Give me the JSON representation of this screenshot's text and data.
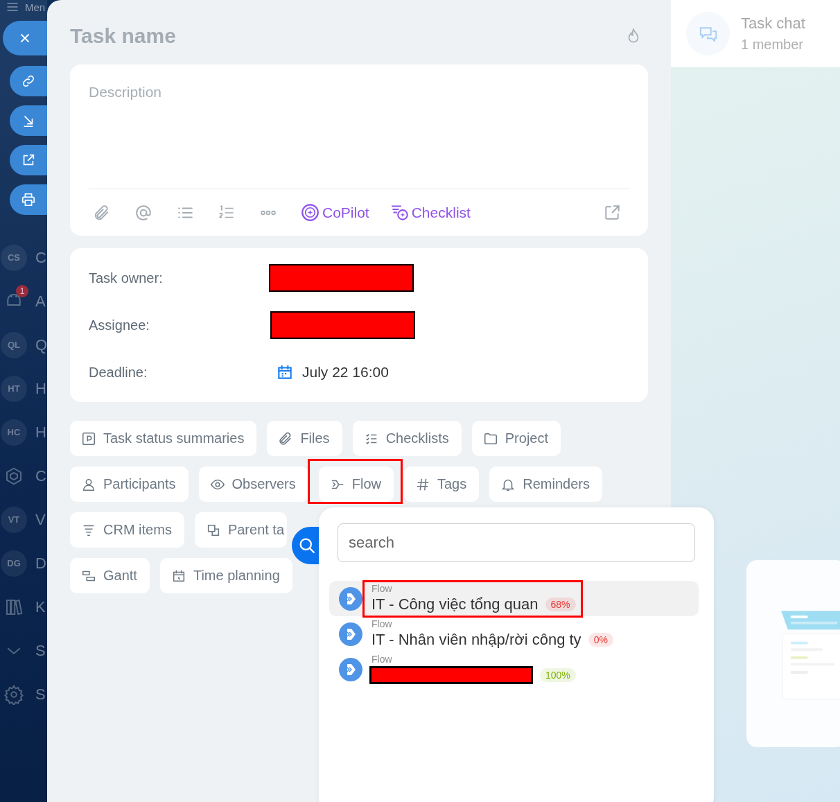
{
  "sidebar": {
    "menu_label": "Men",
    "items": [
      {
        "kind": "avatar",
        "initials": "CS",
        "label": "C"
      },
      {
        "kind": "icon",
        "label": "A",
        "badge": "1"
      },
      {
        "kind": "avatar",
        "initials": "QL",
        "label": "Q"
      },
      {
        "kind": "avatar",
        "initials": "HT",
        "label": "H"
      },
      {
        "kind": "avatar",
        "initials": "HC",
        "label": "H"
      },
      {
        "kind": "icon",
        "label": "C"
      },
      {
        "kind": "avatar",
        "initials": "VT",
        "label": "V"
      },
      {
        "kind": "avatar",
        "initials": "DG",
        "label": "D"
      },
      {
        "kind": "icon",
        "label": "K"
      },
      {
        "kind": "icon",
        "label": "S"
      },
      {
        "kind": "icon",
        "label": "S"
      }
    ]
  },
  "task": {
    "title": "Task name",
    "description": {
      "placeholder": "Description"
    },
    "toolbar": [
      {
        "label": "CoPilot"
      },
      {
        "label": "Checklist"
      }
    ],
    "fields": [
      {
        "label": "Task owner:",
        "kind": "person"
      },
      {
        "label": "Assignee:",
        "kind": "person"
      },
      {
        "label": "Deadline:",
        "kind": "date",
        "value": "July 22 16:00"
      }
    ],
    "chip_rows": [
      [
        {
          "label": "Task status summaries",
          "highlighted": false
        },
        {
          "label": "Files",
          "highlighted": false
        },
        {
          "label": "Checklists",
          "highlighted": false
        },
        {
          "label": "Project",
          "highlighted": false
        }
      ],
      [
        {
          "label": "Participants",
          "highlighted": false
        },
        {
          "label": "Observers",
          "highlighted": false
        },
        {
          "label": "Flow",
          "highlighted": true
        },
        {
          "label": "Tags",
          "highlighted": false
        },
        {
          "label": "Reminders",
          "highlighted": false
        }
      ],
      [
        {
          "label": "CRM items",
          "highlighted": false
        },
        {
          "label": "Parent ta",
          "highlighted": false
        }
      ],
      [
        {
          "label": "Gantt",
          "highlighted": false
        },
        {
          "label": "Time planning",
          "highlighted": false
        }
      ]
    ]
  },
  "flow_popup": {
    "search": {
      "placeholder": "search"
    },
    "items": [
      {
        "type": "Flow",
        "name": "IT - Công việc tổng quan",
        "percent": "68%",
        "color": "#e53935",
        "selected": true,
        "highlighted": true
      },
      {
        "type": "Flow",
        "name": "IT - Nhân viên nhập/rời công ty",
        "percent": "0%",
        "color": "#e53935",
        "selected": false,
        "highlighted": false
      },
      {
        "type": "Flow",
        "percent": "100%",
        "color": "#7cb305",
        "selected": false,
        "highlighted": false
      }
    ]
  },
  "chat": {
    "title": "Task chat",
    "members": "1 member"
  }
}
